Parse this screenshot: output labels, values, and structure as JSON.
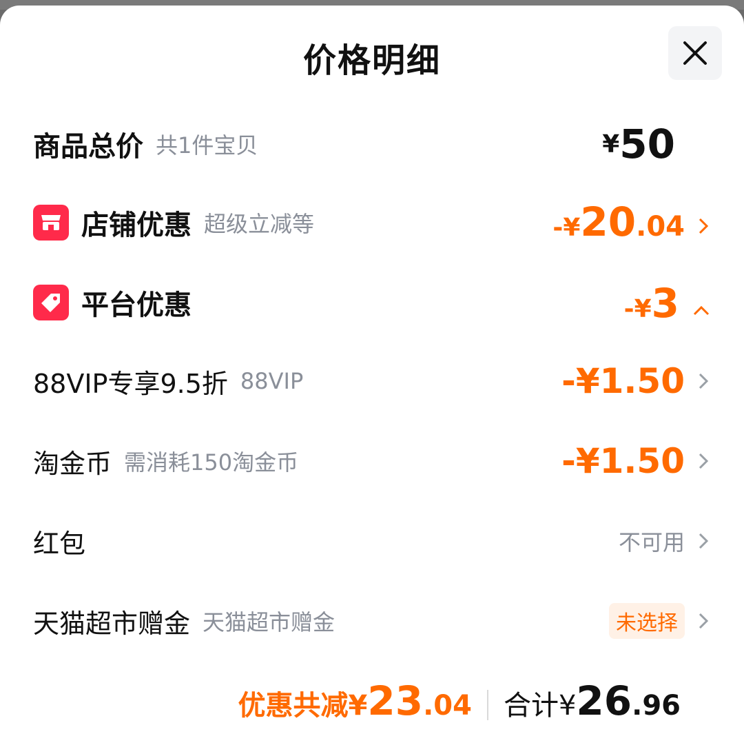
{
  "dialog": {
    "title": "价格明细"
  },
  "total": {
    "label": "商品总价",
    "sub": "共1件宝贝",
    "currency": "¥",
    "amount": "50"
  },
  "shop_discount": {
    "label": "店铺优惠",
    "sub": "超级立减等",
    "prefix": "-¥",
    "int": "20",
    "dec": ".04"
  },
  "platform_discount": {
    "label": "平台优惠",
    "prefix": "-¥",
    "amount": "3"
  },
  "items": [
    {
      "label": "88VIP专享9.5折",
      "sub": "88VIP",
      "value": "-¥1.50"
    },
    {
      "label": "淘金币",
      "sub": "需消耗150淘金币",
      "value": "-¥1.50"
    },
    {
      "label": "红包",
      "sub": "",
      "status": "不可用"
    },
    {
      "label": "天猫超市赠金",
      "sub": "天猫超市赠金",
      "pill": "未选择"
    }
  ],
  "footer": {
    "discount_label": "优惠共减¥",
    "discount_int": "23",
    "discount_dec": ".04",
    "total_label": "合计¥",
    "total_int": "26",
    "total_dec": ".96"
  },
  "colors": {
    "accent": "#ff6a00",
    "badge": "#ff2a4a"
  }
}
